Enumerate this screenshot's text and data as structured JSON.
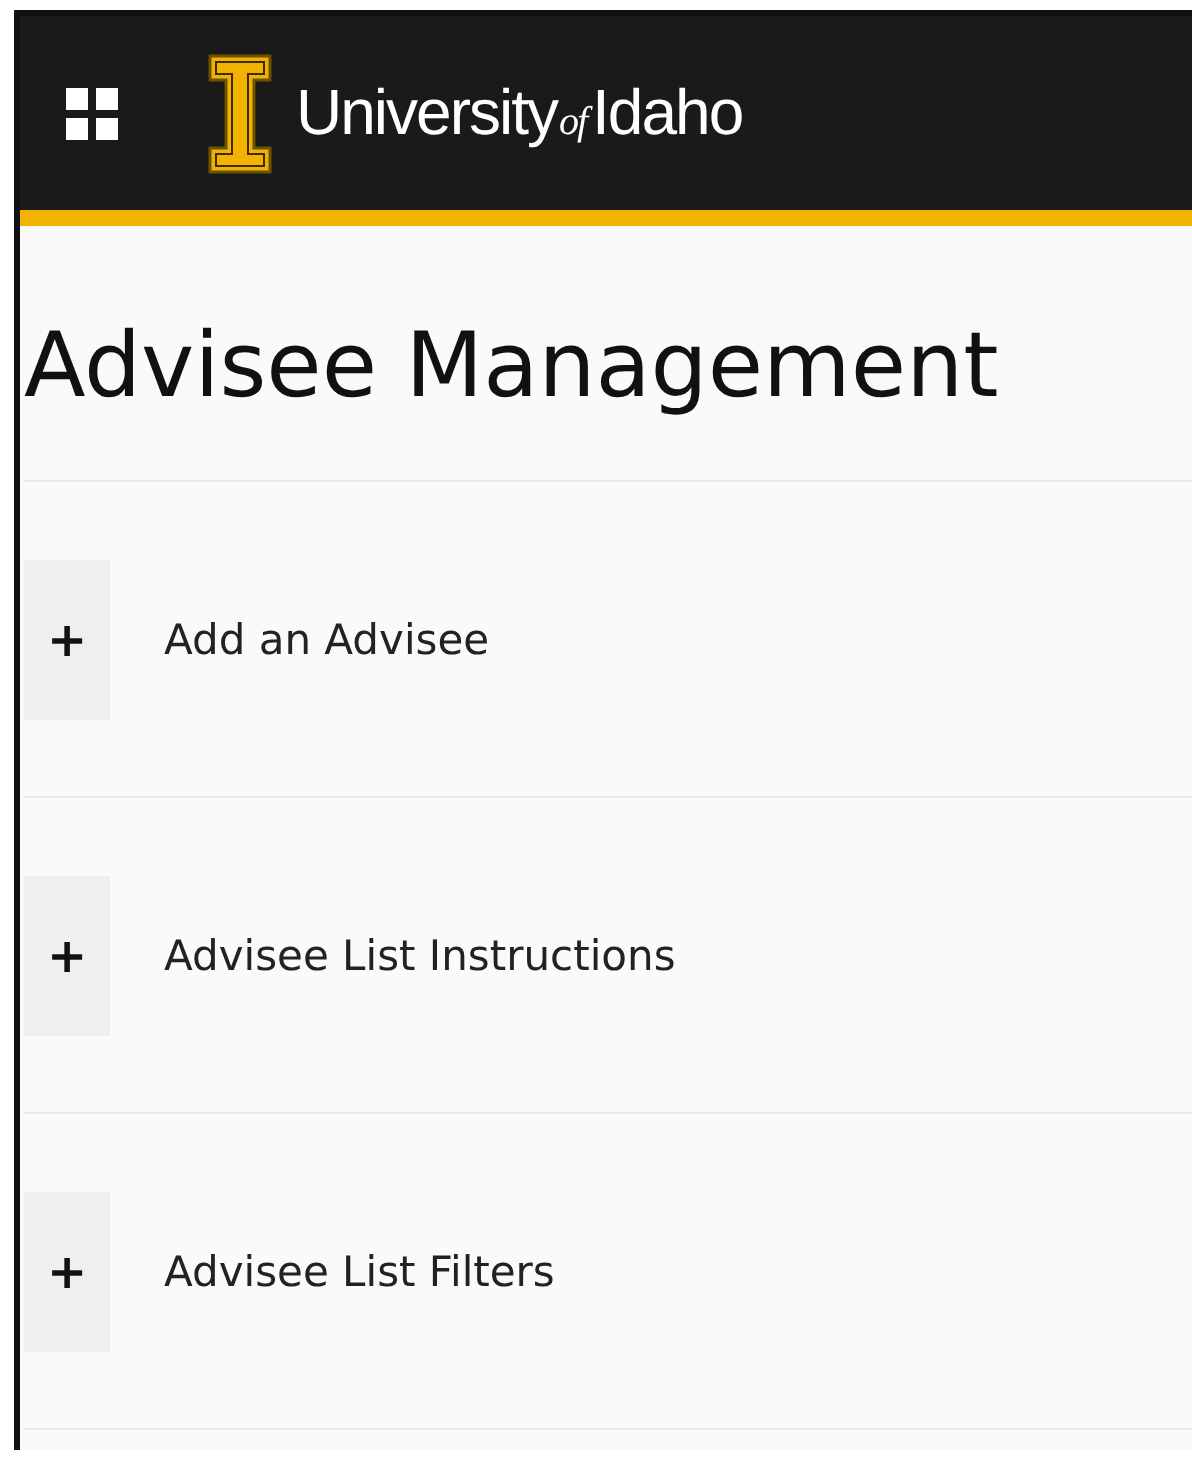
{
  "header": {
    "logo_words": [
      "University",
      "of",
      "Idaho"
    ]
  },
  "page_title": "Advisee Management",
  "sections": [
    {
      "icon": "+",
      "label": "Add an Advisee"
    },
    {
      "icon": "+",
      "label": "Advisee List Instructions"
    },
    {
      "icon": "+",
      "label": "Advisee List Filters"
    }
  ]
}
